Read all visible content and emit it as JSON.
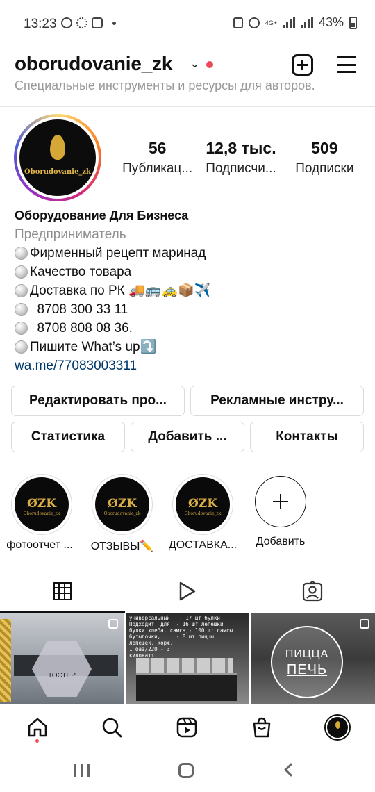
{
  "status_bar": {
    "time": "13:23",
    "network": "4G+",
    "battery": "43%"
  },
  "header": {
    "username": "oborudovanie_zk",
    "subtitle": "Специальные инструменты и ресурсы для авторов."
  },
  "profile": {
    "avatar_text": "Oborudovanie_zk",
    "stats": [
      {
        "value": "56",
        "label": "Публикац..."
      },
      {
        "value": "12,8 тыс.",
        "label": "Подписчи..."
      },
      {
        "value": "509",
        "label": "Подписки"
      }
    ],
    "name": "Оборудование Для Бизнеса",
    "category": "Предприниматель",
    "bio_lines": [
      "Фирменный  рецепт маринад",
      "Качество товара",
      "Доставка по РК 🚚🚌🚕📦✈️",
      "  8708 300 33 11",
      "  8708 808 08 36.",
      "Пишите What’s up⤵️"
    ],
    "link": "wa.me/77083003311"
  },
  "buttons": {
    "edit": "Редактировать про...",
    "ads": "Рекламные инстру...",
    "stats": "Статистика",
    "add": "Добавить ...",
    "contacts": "Контакты"
  },
  "highlights": [
    {
      "logo": "ØZK",
      "sub": "Oborudovanie_zk",
      "label": "фотоотчет ..."
    },
    {
      "logo": "ØZK",
      "sub": "Oborudovanie_zk",
      "label": "ОТЗЫВЫ✏️"
    },
    {
      "logo": "ØZK",
      "sub": "Oborudovanie_zk",
      "label": "ДОСТАВКА..."
    },
    {
      "label": "Добавить"
    }
  ],
  "posts": [
    {
      "label": "ТОСТЕР"
    },
    {
      "text": "универсальный   - 17 шт булки\nПодходит  для  - 16 шт лепешки\nбулки хлеба, самса,- 100 шт самсы\nбутылочки,     - 8 шт пиццы\nлепёшек, корж.\n1 фаз/220 - 3\nкиловатт"
    },
    {
      "line1": "ПИЦЦА",
      "line2": "ПЕЧЬ"
    }
  ],
  "colors": {
    "notification_red": "#ed4956",
    "link_blue": "#00376b",
    "brand_gold": "#d4a737"
  }
}
